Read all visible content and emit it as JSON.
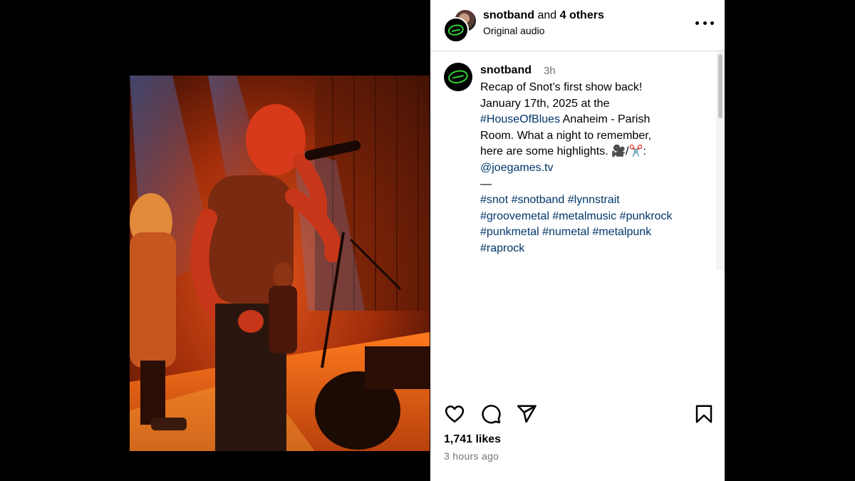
{
  "header": {
    "author": "snotband",
    "and_text": "and",
    "others": "4 others",
    "audio": "Original audio",
    "more_icon": "more-horizontal-icon"
  },
  "caption": {
    "author": "snotband",
    "time": "3h",
    "lines": {
      "l1": "Recap of Snot’s first show back!",
      "l2": "January 17th, 2025 at the",
      "l3_tag": "#HouseOfBlues",
      "l3_rest": " Anaheim - Parish",
      "l4": "Room. What a night to remember,",
      "l5": "here are some highlights. 🎥/✂️:",
      "l6_mention": "@joegames.tv",
      "l7": "—"
    },
    "hashtags": [
      "#snot",
      "#snotband",
      "#lynnstrait",
      "#groovemetal",
      "#metalmusic",
      "#punkrock",
      "#punkmetal",
      "#numetal",
      "#metalpunk",
      "#raprock"
    ]
  },
  "actions": {
    "icons": [
      "heart-icon",
      "comment-icon",
      "share-icon",
      "bookmark-icon"
    ],
    "likes": "1,741 likes",
    "time_ago": "3 hours ago"
  },
  "colors": {
    "link": "#00376b",
    "muted": "#737373",
    "logo_green": "#35d33a"
  }
}
